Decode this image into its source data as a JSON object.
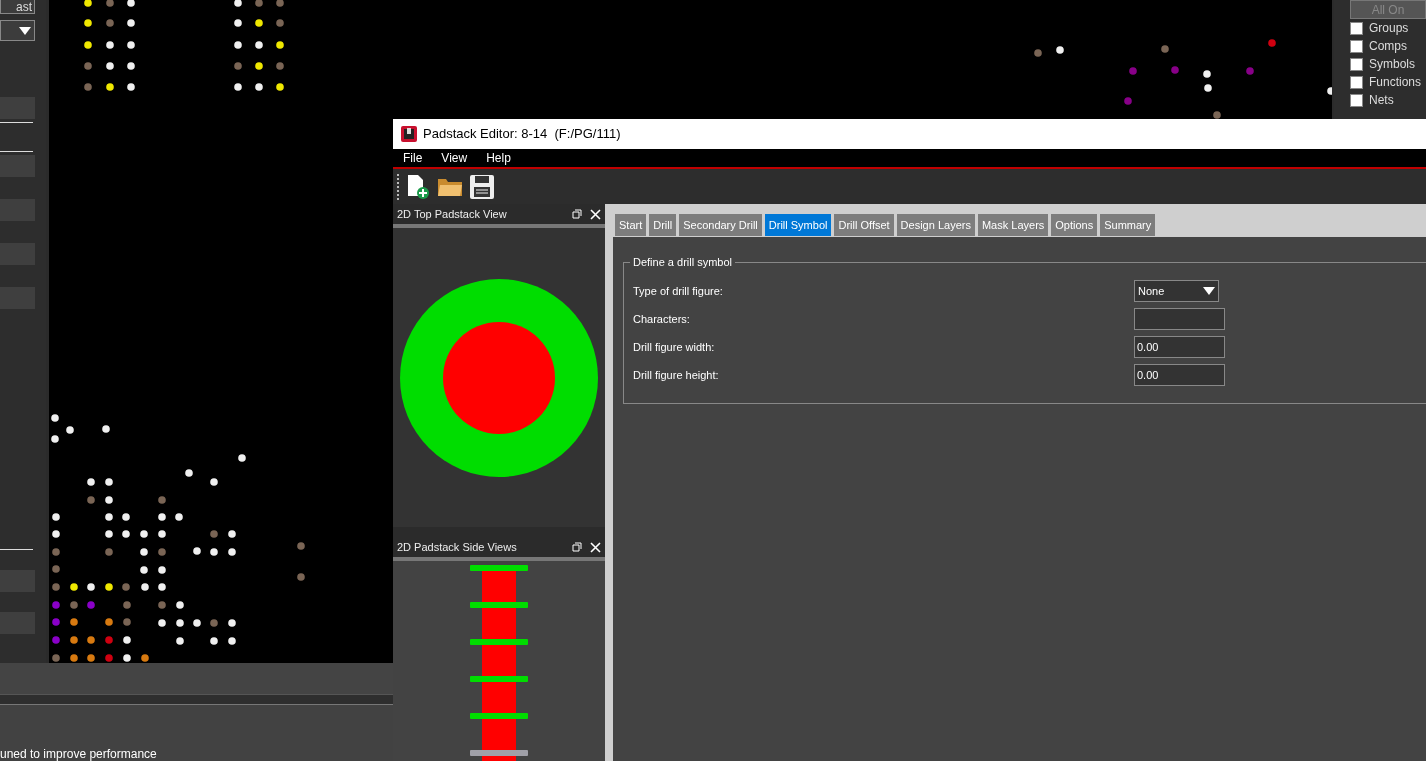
{
  "background_app": {
    "left_panel": {
      "button_label": "ast"
    },
    "layers_panel": {
      "all_on": "All On",
      "items": [
        {
          "label": "Groups",
          "checked": false
        },
        {
          "label": "Comps",
          "checked": false
        },
        {
          "label": "Symbols",
          "checked": false
        },
        {
          "label": "Functions",
          "checked": false
        },
        {
          "label": "Nets",
          "checked": false
        }
      ]
    },
    "status_message": "uned to improve performance"
  },
  "window": {
    "title": "Padstack Editor: 8-14  (F:/PG/111)",
    "menu": [
      "File",
      "View",
      "Help"
    ],
    "panels": [
      {
        "title": "2D Top Padstack View"
      },
      {
        "title": "2D Padstack Side Views"
      }
    ],
    "tabs": [
      {
        "label": "Start",
        "selected": false
      },
      {
        "label": "Drill",
        "selected": false
      },
      {
        "label": "Secondary Drill",
        "selected": false
      },
      {
        "label": "Drill Symbol",
        "selected": true
      },
      {
        "label": "Drill Offset",
        "selected": false
      },
      {
        "label": "Design Layers",
        "selected": false
      },
      {
        "label": "Mask Layers",
        "selected": false
      },
      {
        "label": "Options",
        "selected": false
      },
      {
        "label": "Summary",
        "selected": false
      }
    ],
    "group": {
      "title": "Define a drill symbol",
      "fields": [
        {
          "label": "Type of drill figure:",
          "kind": "dropdown",
          "value": "None"
        },
        {
          "label": "Characters:",
          "kind": "text"
        },
        {
          "label": "Drill figure width:",
          "kind": "text",
          "value": "0.00"
        },
        {
          "label": "Drill figure height:",
          "kind": "text",
          "value": "0.00"
        }
      ]
    }
  }
}
